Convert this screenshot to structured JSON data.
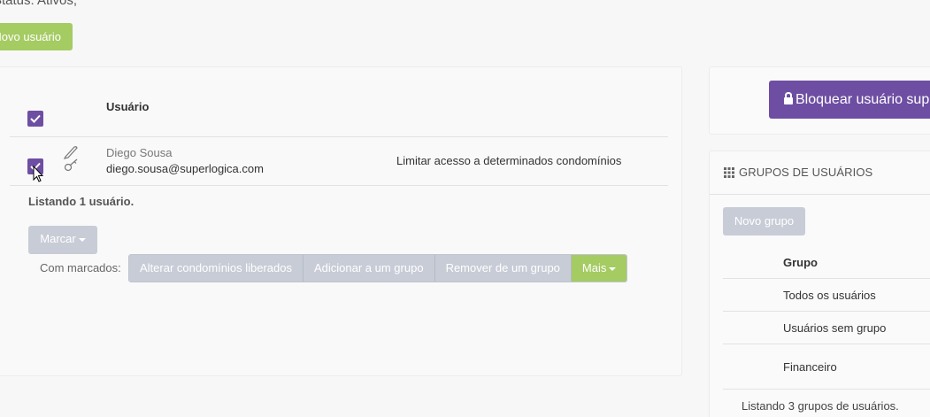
{
  "filter": {
    "status_text": "Status: Ativos;"
  },
  "toolbar": {
    "new_user_label": "Novo usuário"
  },
  "users_table": {
    "header_user": "Usuário",
    "rows": [
      {
        "name": "Diego Sousa",
        "email": "diego.sousa@superlogica.com",
        "access": "Limitar acesso a determinados condomínios"
      }
    ],
    "listing": "Listando 1 usuário."
  },
  "actions": {
    "mark_label": "Marcar",
    "with_marked_label": "Com marcados:",
    "buttons": [
      "Alterar condomínios liberados",
      "Adicionar a um grupo",
      "Remover de um grupo",
      "Mais"
    ]
  },
  "sidebar": {
    "block_user_label": "Bloquear usuário sup",
    "groups_title": "GRUPOS DE USUÁRIOS",
    "new_group_label": "Novo grupo",
    "groups_header": "Grupo",
    "groups": [
      "Todos os usuários",
      "Usuários sem grupo",
      "Financeiro"
    ],
    "groups_listing": "Listando 3 grupos de usuários."
  },
  "colors": {
    "purple": "#6e4ea3",
    "green": "#a5cb63",
    "gray_button": "#c8ccd6"
  }
}
